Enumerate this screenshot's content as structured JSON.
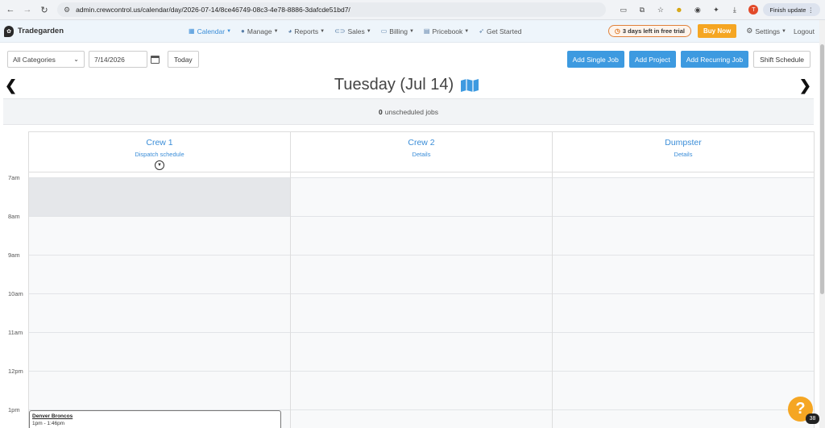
{
  "browser": {
    "url": "admin.crewcontrol.us/calendar/day/2026-07-14/8ce46749-08c3-4e78-8886-3dafcde51bd7/",
    "profile_initial": "T",
    "finish_update": "Finish update"
  },
  "nav": {
    "brand": "Tradegarden",
    "menu": [
      {
        "label": "Calendar",
        "icon": "calendar-icon"
      },
      {
        "label": "Manage",
        "icon": "person-icon"
      },
      {
        "label": "Reports",
        "icon": "palette-icon"
      },
      {
        "label": "Sales",
        "icon": "handshake-icon"
      },
      {
        "label": "Billing",
        "icon": "card-icon"
      },
      {
        "label": "Pricebook",
        "icon": "book-icon"
      },
      {
        "label": "Get Started",
        "icon": "rocket-icon"
      }
    ],
    "trial": "3 days left in free trial",
    "buy": "Buy Now",
    "settings": "Settings",
    "logout": "Logout",
    "accent": "#3a8dd8"
  },
  "toolbar": {
    "category": "All Categories",
    "date": "7/14/2026",
    "today": "Today",
    "add_single": "Add Single Job",
    "add_project": "Add Project",
    "add_recurring": "Add Recurring Job",
    "shift_schedule": "Shift Schedule"
  },
  "day": {
    "title": "Tuesday (Jul 14)",
    "unscheduled_count": "0",
    "unscheduled_label": "unscheduled jobs"
  },
  "crews": [
    {
      "name": "Crew 1",
      "link": "Dispatch schedule"
    },
    {
      "name": "Crew 2",
      "link": "Details"
    },
    {
      "name": "Dumpster",
      "link": "Details"
    }
  ],
  "hours": [
    "7am",
    "8am",
    "9am",
    "10am",
    "11am",
    "12pm",
    "1pm"
  ],
  "job": {
    "title": "Denver Broncos",
    "time": "1pm - 1:46pm"
  },
  "help": {
    "icon": "?",
    "count": "38"
  }
}
